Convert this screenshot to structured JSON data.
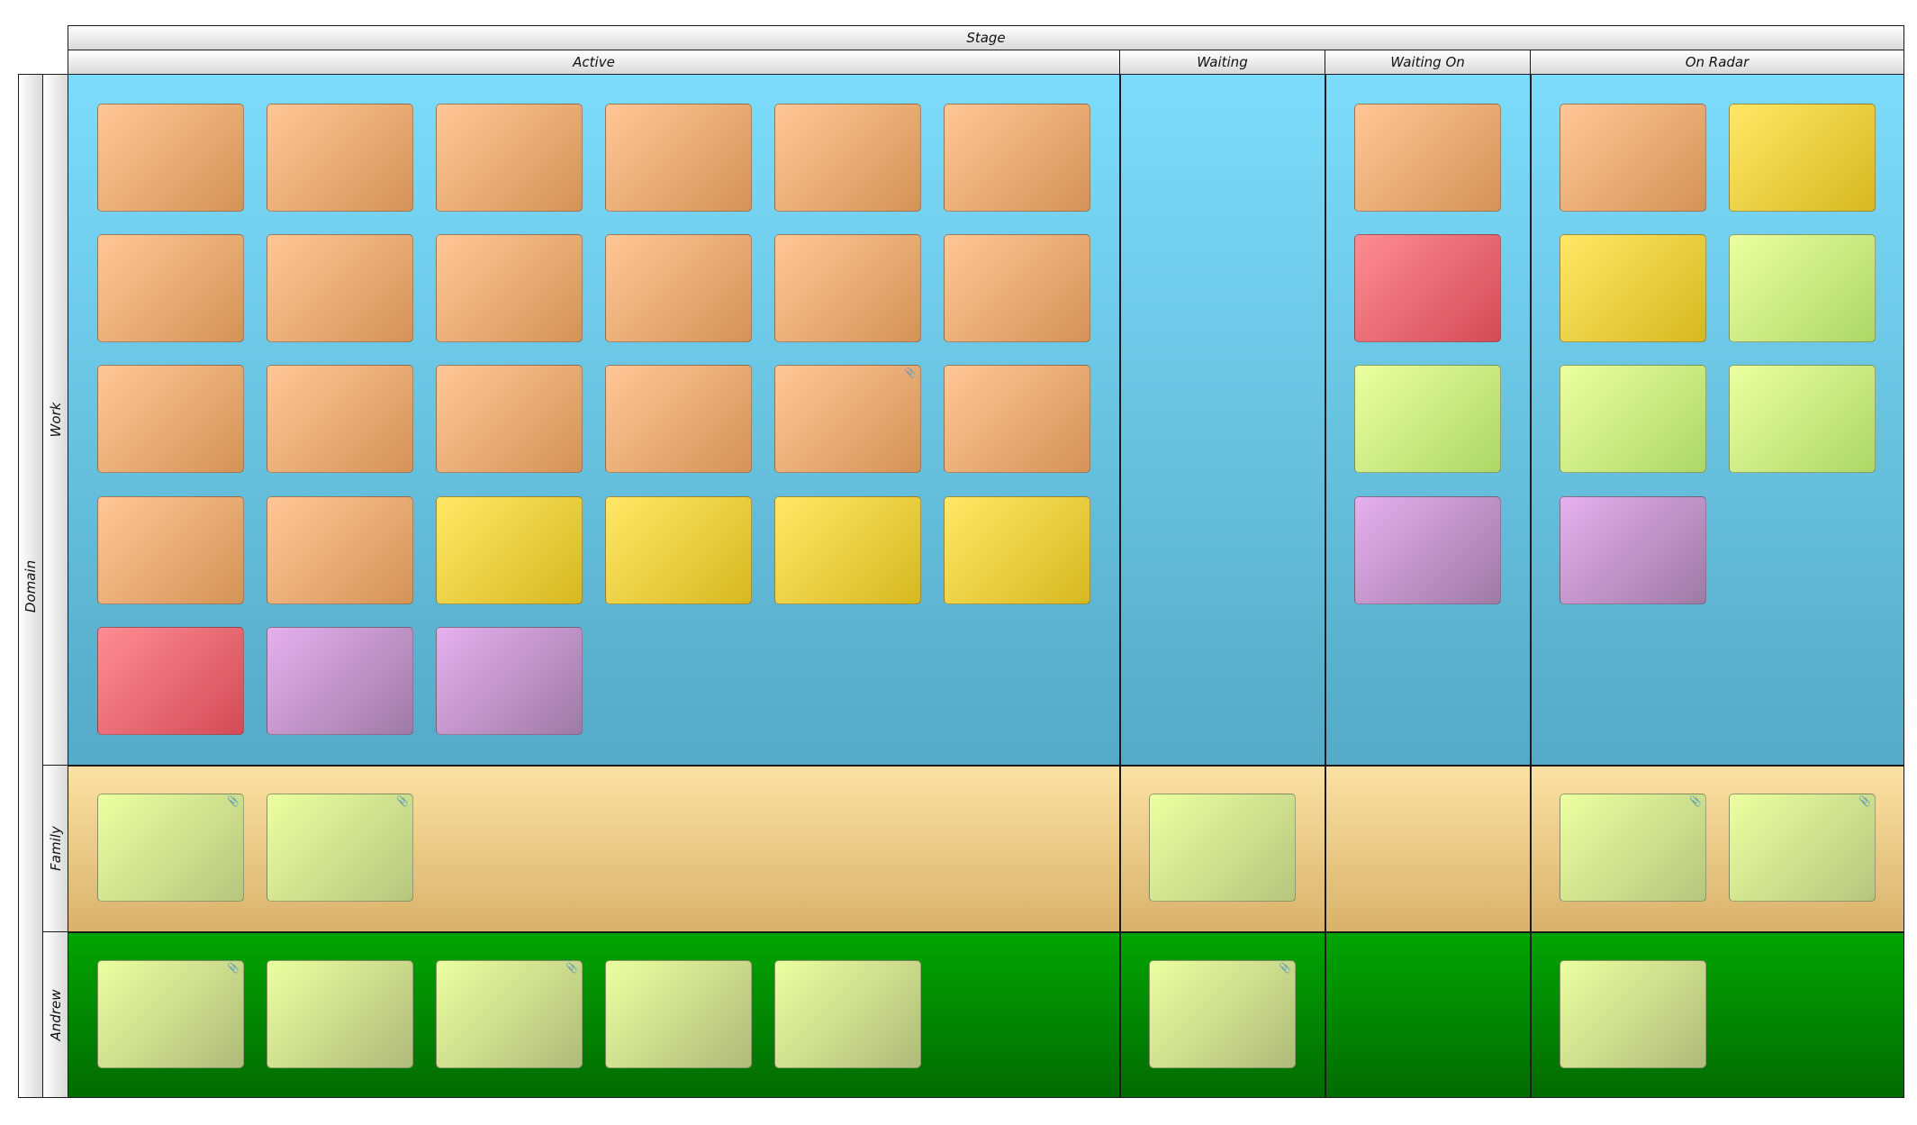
{
  "board": {
    "column_header": "Stage",
    "row_header": "Domain",
    "columns": [
      "Active",
      "Waiting",
      "Waiting On",
      "On Radar"
    ],
    "rows": [
      "Work",
      "Family",
      "Andrew"
    ]
  },
  "colors": {
    "work_lane": "#7ddcfb",
    "family_lane": "#fbe2a4",
    "andrew_lane": "#02a502",
    "card_orange": "#ffc796",
    "card_yellow": "#ffe866",
    "card_red": "#ff8c94",
    "card_purple": "#e5b0ee",
    "card_lime": "#ecffa0"
  },
  "cards": {
    "work_active": [
      "orange",
      "orange",
      "orange",
      "orange",
      "orange",
      "orange",
      "orange",
      "orange",
      "orange",
      "orange",
      "orange",
      "orange",
      "orange",
      "orange",
      "orange",
      "orange",
      "orange+attachment",
      "orange",
      "orange",
      "orange",
      "yellow",
      "yellow",
      "yellow",
      "yellow",
      "red",
      "purple",
      "purple"
    ],
    "work_waiting": [],
    "work_waiting_on": [
      "orange",
      "red",
      "lime",
      "purple"
    ],
    "work_on_radar": [
      "orange",
      "yellow",
      "yellow",
      "lime",
      "lime",
      "lime",
      "purple"
    ],
    "family_active": [
      "lime+attachment",
      "lime+attachment"
    ],
    "family_waiting": [
      "lime"
    ],
    "family_waiting_on": [],
    "family_on_radar": [
      "lime+attachment",
      "lime+attachment"
    ],
    "andrew_active": [
      "lime+attachment",
      "lime",
      "lime+attachment",
      "lime",
      "lime"
    ],
    "andrew_waiting": [
      "lime+attachment"
    ],
    "andrew_waiting_on": [],
    "andrew_on_radar": [
      "lime"
    ]
  },
  "icons": {
    "attachment": "paperclip-icon"
  }
}
